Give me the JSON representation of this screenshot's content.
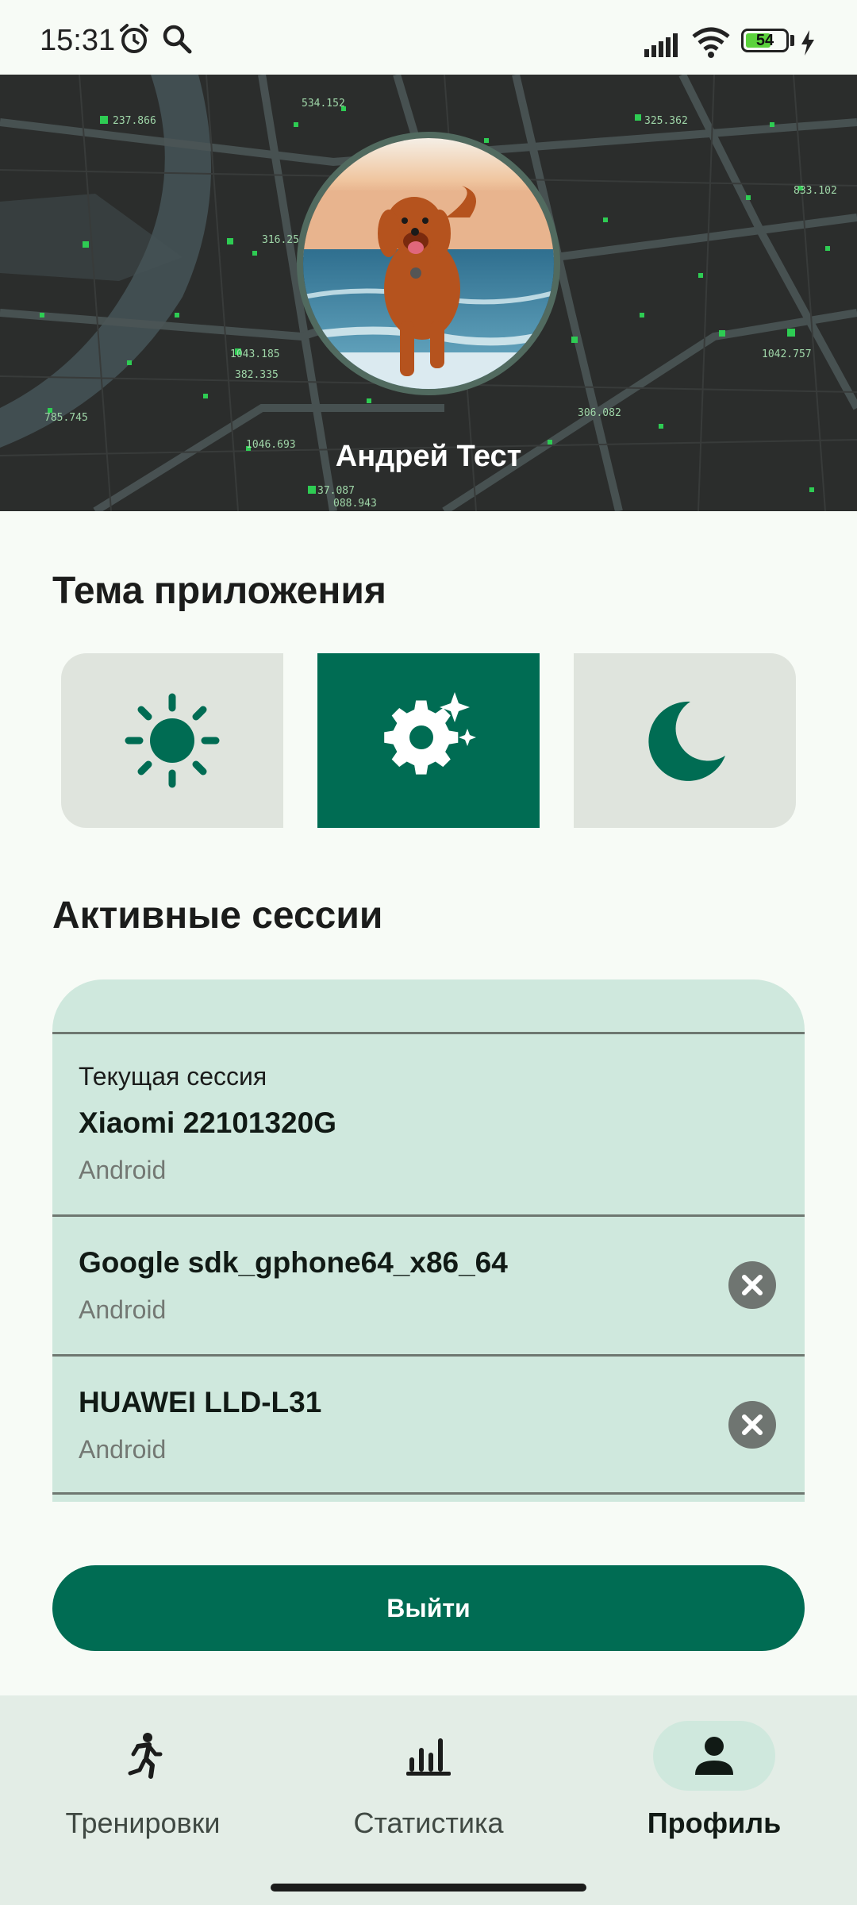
{
  "status_bar": {
    "time": "15:31",
    "battery": "54",
    "icons": [
      "alarm-icon",
      "search-icon",
      "signal-icon",
      "wifi-icon",
      "battery-icon",
      "charging-icon"
    ]
  },
  "profile": {
    "user_name": "Андрей Тест",
    "avatar": "dog-photo"
  },
  "theme": {
    "title": "Тема приложения",
    "options": [
      {
        "id": "light",
        "icon": "sun-icon",
        "selected": false
      },
      {
        "id": "system",
        "icon": "auto-theme-gear-icon",
        "selected": true
      },
      {
        "id": "dark",
        "icon": "moon-icon",
        "selected": false
      }
    ],
    "accent_color": "#006c53"
  },
  "sessions": {
    "title": "Активные сессии",
    "current": {
      "label": "Текущая сессия",
      "device": "Xiaomi 22101320G",
      "os": "Android"
    },
    "others": [
      {
        "device": "Google sdk_gphone64_x86_64",
        "os": "Android"
      },
      {
        "device": "HUAWEI LLD-L31",
        "os": "Android"
      }
    ]
  },
  "logout": {
    "label": "Выйти"
  },
  "nav": {
    "items": [
      {
        "label": "Тренировки",
        "icon": "running-icon",
        "active": false
      },
      {
        "label": "Статистика",
        "icon": "bar-chart-icon",
        "active": false
      },
      {
        "label": "Профиль",
        "icon": "person-icon",
        "active": true
      }
    ]
  },
  "map_labels": [
    "237.866",
    "534.152",
    "325.362",
    "833.102",
    "316.253",
    "1043.185",
    "382.335",
    "785.745",
    "306.082",
    "1046.693",
    "37.087",
    "088.943",
    "1042.757"
  ]
}
